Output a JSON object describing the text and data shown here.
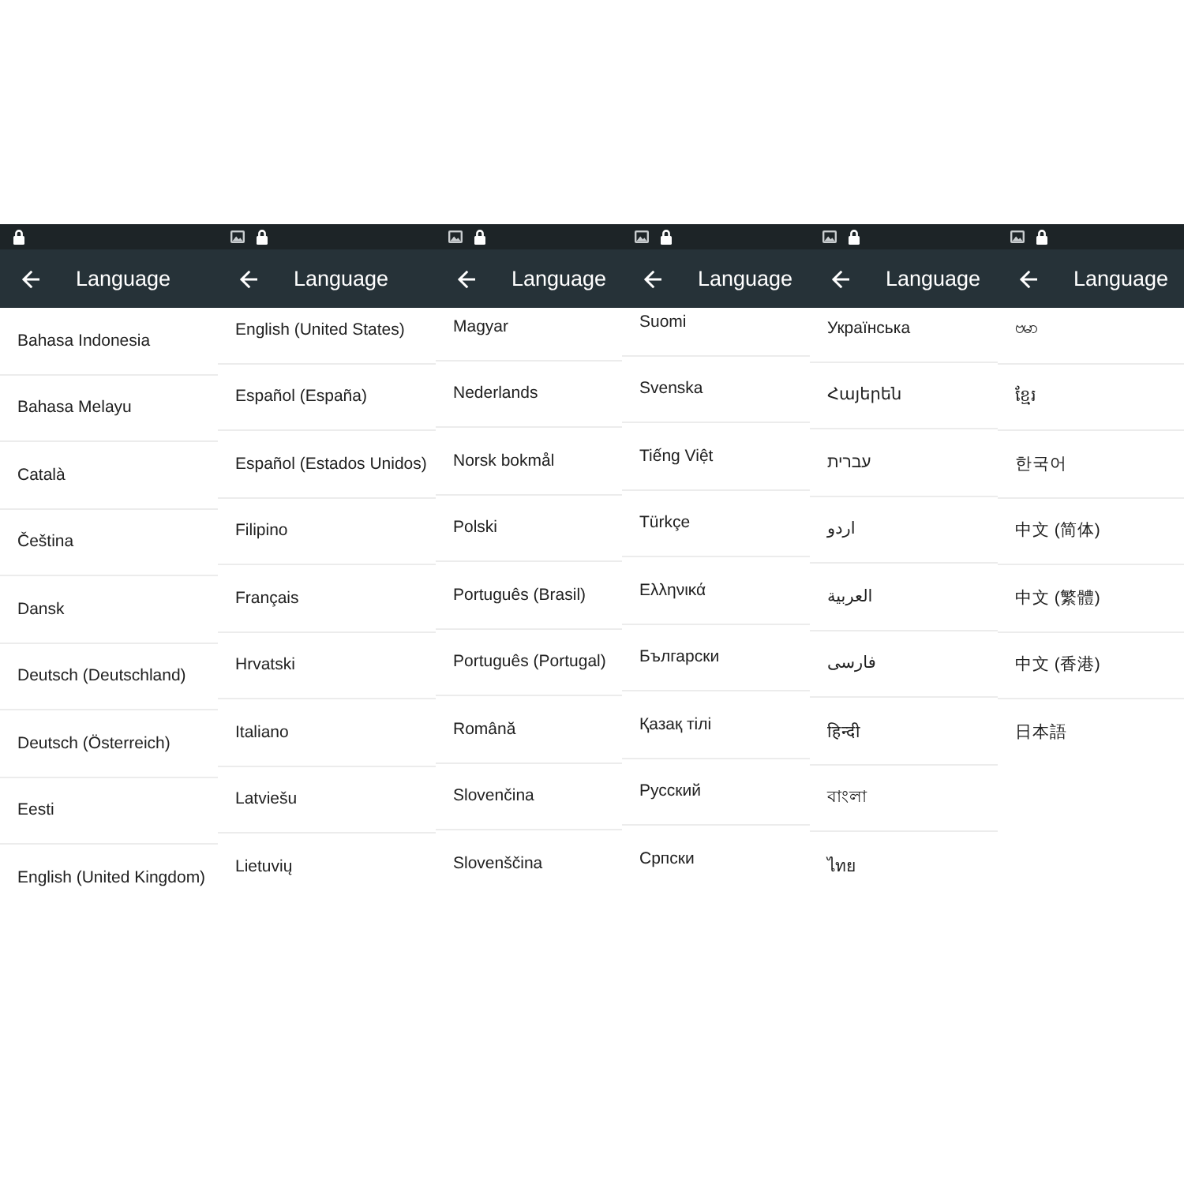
{
  "screens": [
    {
      "status_bar": {
        "image_notification": false
      },
      "title": "Language",
      "languages": [
        {
          "label": "Bahasa Indonesia"
        },
        {
          "label": "Bahasa Melayu"
        },
        {
          "label": "Català"
        },
        {
          "label": "Čeština"
        },
        {
          "label": "Dansk"
        },
        {
          "label": "Deutsch (Deutschland)"
        },
        {
          "label": "Deutsch (Österreich)"
        },
        {
          "label": "Eesti"
        },
        {
          "label": "English (United Kingdom)"
        }
      ]
    },
    {
      "status_bar": {
        "image_notification": true
      },
      "title": "Language",
      "languages": [
        {
          "label": "English (United States)"
        },
        {
          "label": "Español (España)"
        },
        {
          "label": "Español (Estados Unidos)"
        },
        {
          "label": "Filipino"
        },
        {
          "label": "Français"
        },
        {
          "label": "Hrvatski"
        },
        {
          "label": "Italiano"
        },
        {
          "label": "Latviešu"
        },
        {
          "label": "Lietuvių"
        }
      ]
    },
    {
      "status_bar": {
        "image_notification": true
      },
      "title": "Language",
      "languages": [
        {
          "label": "Magyar"
        },
        {
          "label": "Nederlands"
        },
        {
          "label": "Norsk bokmål"
        },
        {
          "label": "Polski"
        },
        {
          "label": "Português (Brasil)"
        },
        {
          "label": "Português (Portugal)"
        },
        {
          "label": "Română"
        },
        {
          "label": "Slovenčina"
        },
        {
          "label": "Slovenščina"
        }
      ]
    },
    {
      "status_bar": {
        "image_notification": true
      },
      "title": "Language",
      "languages": [
        {
          "label": "Suomi"
        },
        {
          "label": "Svenska"
        },
        {
          "label": "Tiếng Việt"
        },
        {
          "label": "Türkçe"
        },
        {
          "label": "Ελληνικά"
        },
        {
          "label": "Български"
        },
        {
          "label": "Қазақ тілі"
        },
        {
          "label": "Русский"
        },
        {
          "label": "Српски"
        }
      ]
    },
    {
      "status_bar": {
        "image_notification": true
      },
      "title": "Language",
      "languages": [
        {
          "label": "Українська"
        },
        {
          "label": "Հայերեն"
        },
        {
          "label": "עברית"
        },
        {
          "label": "اردو"
        },
        {
          "label": "العربية"
        },
        {
          "label": "فارسی"
        },
        {
          "label": "हिन्दी"
        },
        {
          "label": "বাংলা"
        },
        {
          "label": "ไทย"
        }
      ]
    },
    {
      "status_bar": {
        "image_notification": true
      },
      "title": "Language",
      "languages": [
        {
          "label": "ဗမာ"
        },
        {
          "label": "ខ្មែរ"
        },
        {
          "label": "한국어"
        },
        {
          "label": "中文 (简体)"
        },
        {
          "label": "中文 (繁體)"
        },
        {
          "label": "中文 (香港)"
        },
        {
          "label": "日本語"
        }
      ]
    }
  ]
}
